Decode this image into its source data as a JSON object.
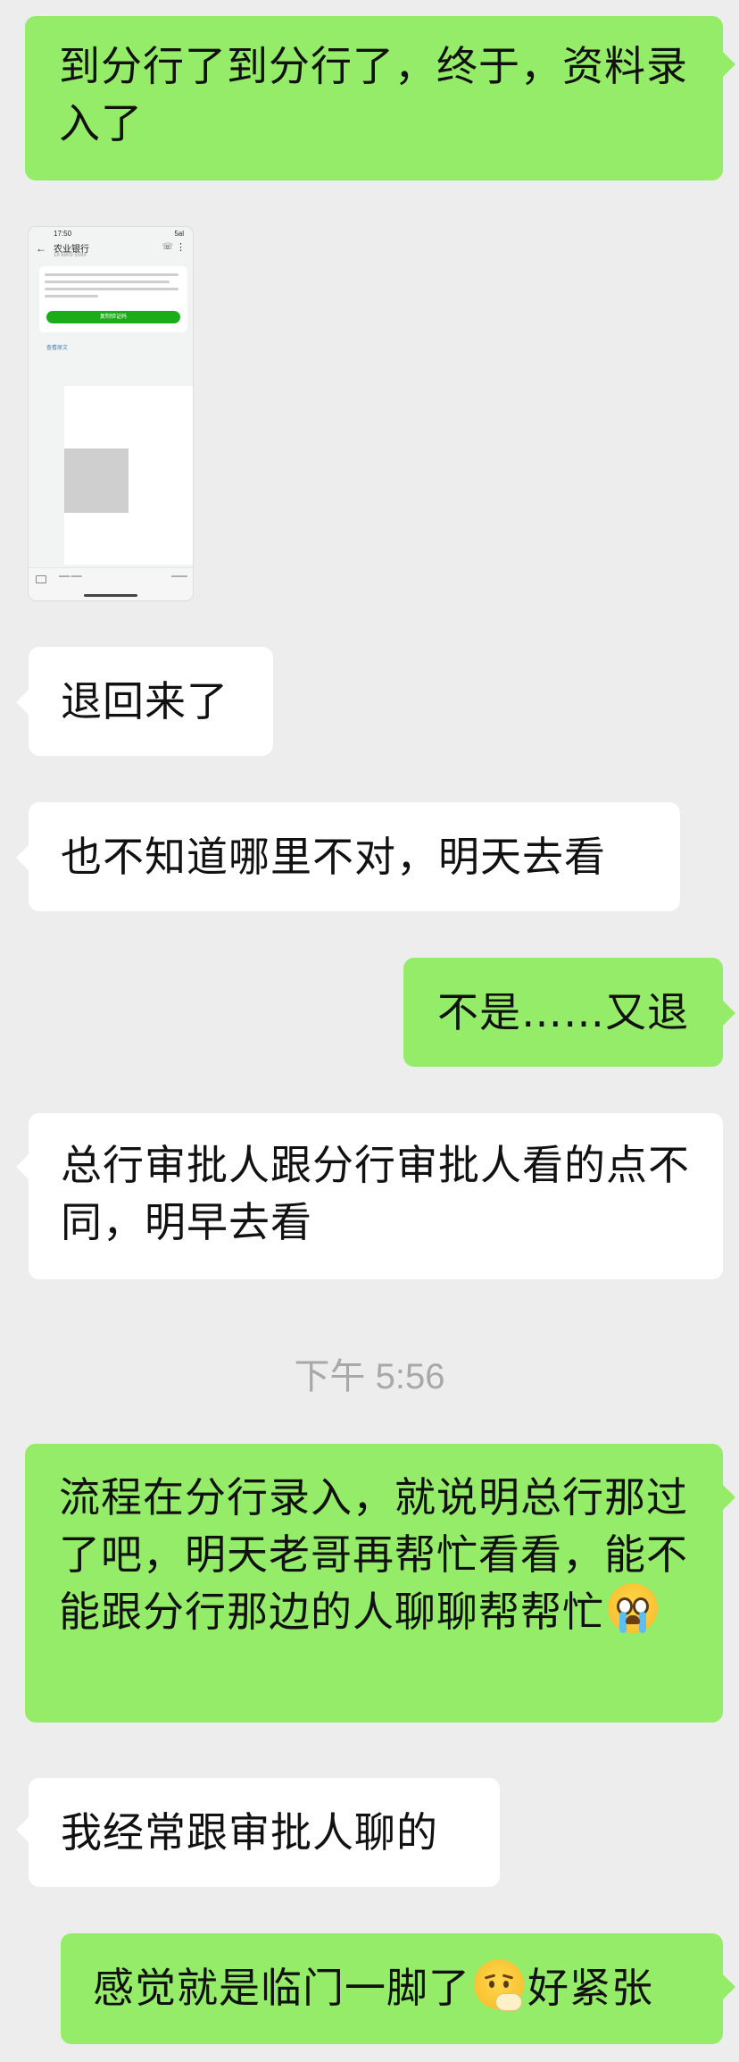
{
  "messages": [
    {
      "side": "right",
      "text": "到分行了到分行了，终于，资料录入了"
    },
    {
      "side": "left",
      "type": "image"
    },
    {
      "side": "left",
      "text": "退回来了"
    },
    {
      "side": "left",
      "text": "也不知道哪里不对，明天去看"
    },
    {
      "side": "right",
      "text": "不是……又退"
    },
    {
      "side": "left",
      "text": "总行审批人跟分行审批人看的点不同，明早去看"
    },
    {
      "side": "right",
      "text": "流程在分行录入，就说明总行那过了吧，明天老哥再帮忙看看，能不能跟分行那边的人聊聊帮帮忙",
      "emoji": "loudly-crying-face"
    },
    {
      "side": "left",
      "text": "我经常跟审批人聊的"
    },
    {
      "side": "right",
      "text_before": "感觉就是临门一脚了",
      "emoji": "nervous-face",
      "text_after": "好紧张"
    }
  ],
  "timestamp": "下午 5:56",
  "screenshot": {
    "time": "17:50",
    "signal": "5al",
    "contact": "农业银行",
    "number": "18 6909 5599",
    "button": "复制验证码",
    "link": "查看原文"
  },
  "colors": {
    "background": "#ededed",
    "sent_bubble": "#95ec69",
    "received_bubble": "#ffffff",
    "timestamp": "#a8a8a8"
  }
}
